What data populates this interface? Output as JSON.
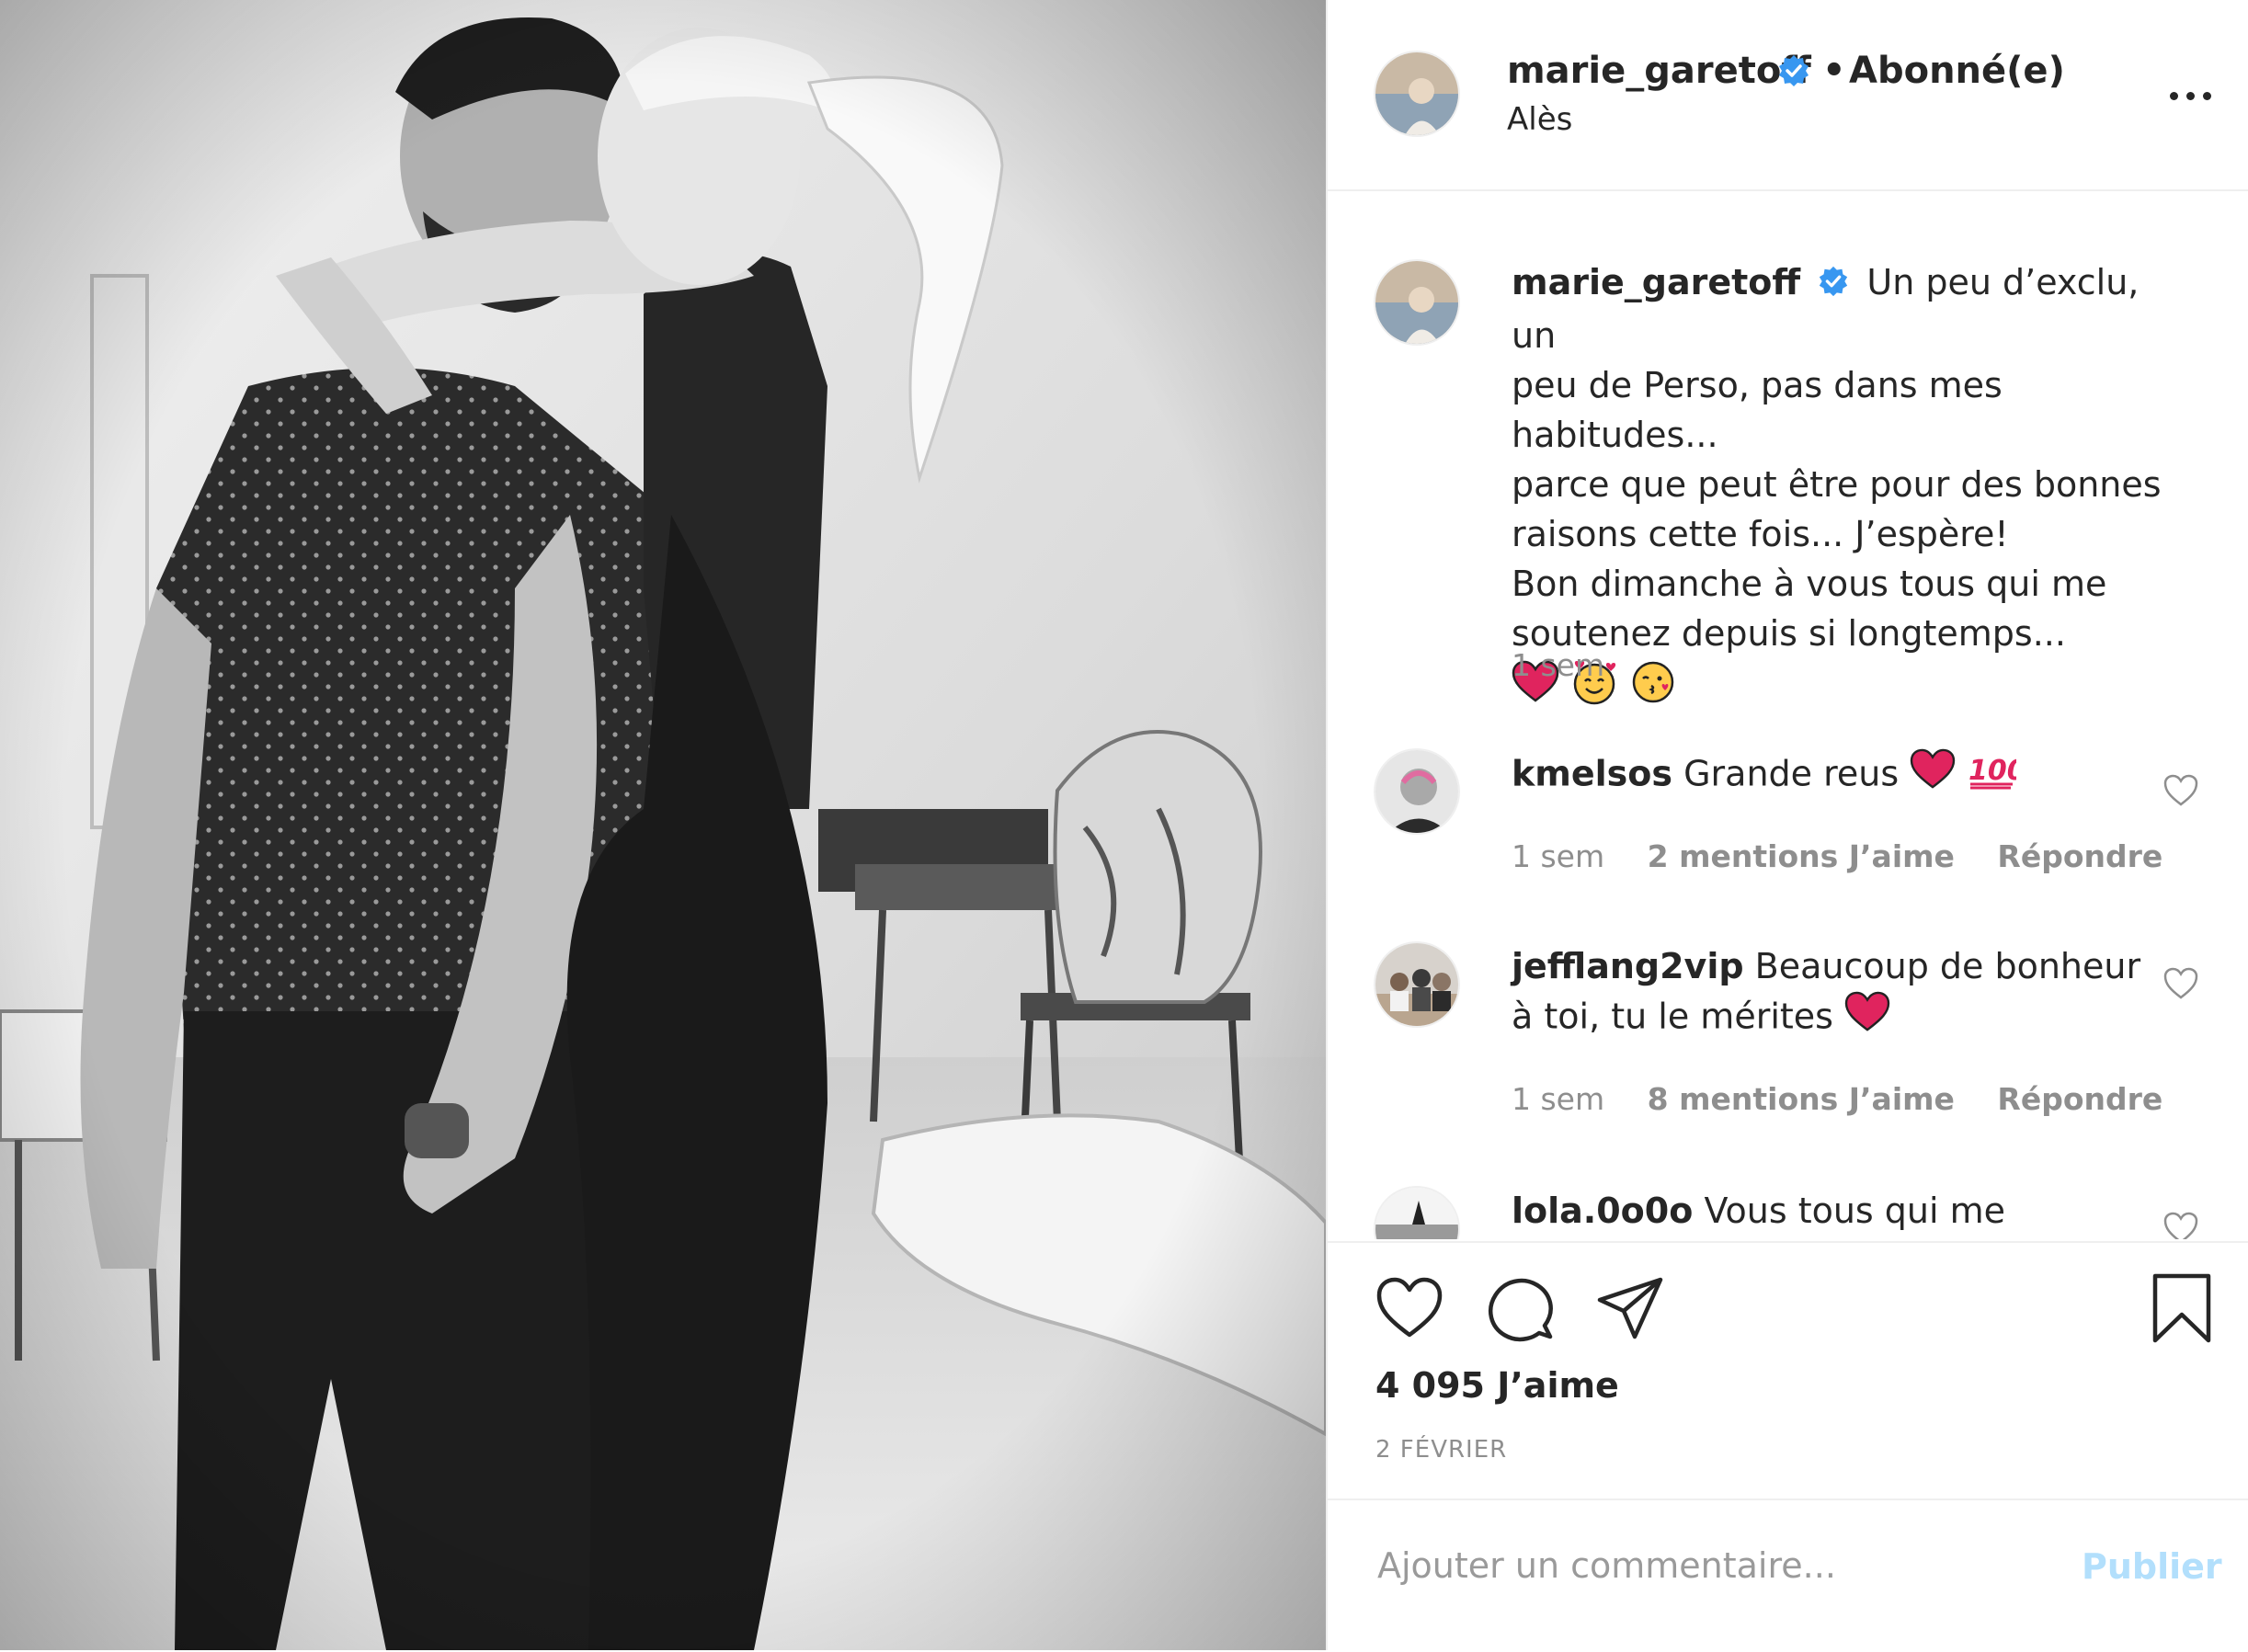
{
  "post": {
    "username": "marie_garetoff",
    "verified": true,
    "separator": "•",
    "follow_status": "Abonné(e)",
    "location": "Alès",
    "more_icon": "more-horizontal-icon"
  },
  "caption": {
    "username": "marie_garetoff",
    "lines": [
      "Un peu d’exclu, un",
      "peu de Perso, pas dans mes habitudes...",
      "parce que peut être pour des bonnes",
      "raisons cette fois... J’espère!",
      "Bon dimanche à vous tous qui me",
      "soutenez depuis si longtemps..."
    ],
    "emojis": [
      "red-heart-emoji",
      "smiling-face-with-hearts-emoji",
      "face-blowing-kiss-emoji"
    ],
    "time": "1 sem"
  },
  "comments": [
    {
      "username": "kmelsos",
      "text": "Grande reus",
      "emojis": [
        "red-heart-emoji",
        "hundred-points-emoji"
      ],
      "time": "1 sem",
      "likes": "2 mentions J’aime",
      "reply": "Répondre"
    },
    {
      "username": "jefflang2vip",
      "text_line1": "Beaucoup de bonheur",
      "text_line2": "à toi, tu le mérites",
      "emojis": [
        "red-heart-emoji"
      ],
      "time": "1 sem",
      "likes": "8 mentions J’aime",
      "reply": "Répondre"
    },
    {
      "username": "lola.0o0o",
      "text": "Vous tous qui me"
    }
  ],
  "actions": {
    "like_icon": "heart-outline-icon",
    "comment_icon": "comment-icon",
    "share_icon": "paper-plane-icon",
    "save_icon": "bookmark-icon",
    "likes_count": "4 095 J’aime",
    "date": "2 FÉVRIER"
  },
  "add_comment": {
    "placeholder": "Ajouter un commentaire...",
    "publish_label": "Publier"
  },
  "colors": {
    "text": "#262626",
    "muted": "#8e8e8e",
    "verified_blue": "#3897f0",
    "publish_disabled": "#b2dffc",
    "heart_red": "#e0245e",
    "divider": "#efefef"
  }
}
